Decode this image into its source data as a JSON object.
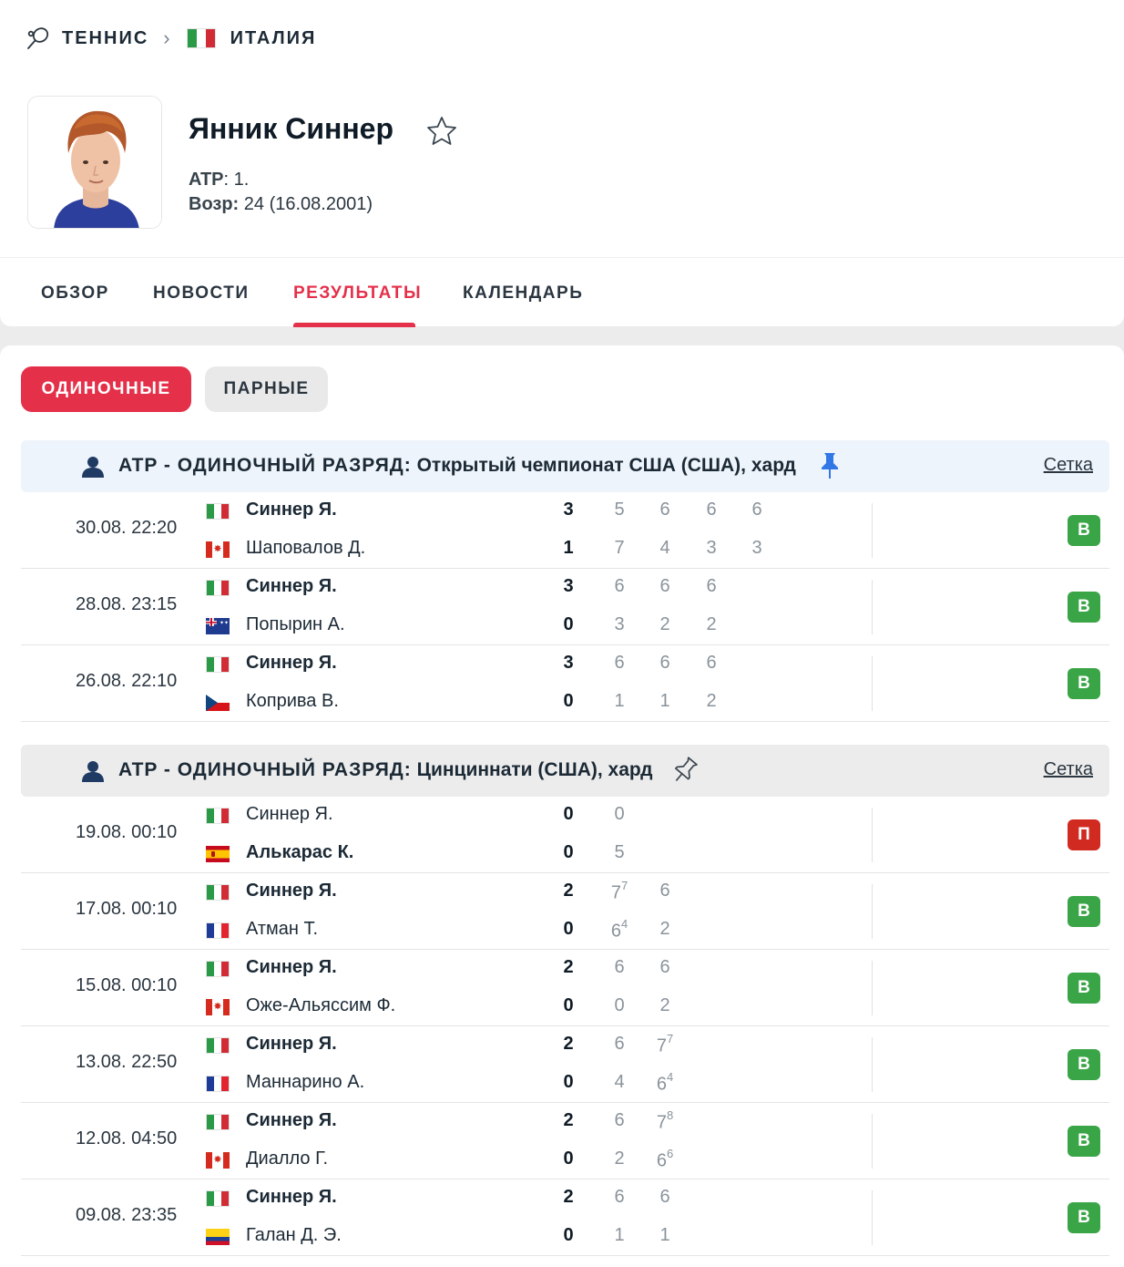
{
  "breadcrumb": {
    "sport": "ТЕННИС",
    "country": "ИТАЛИЯ",
    "sport_icon": "tennis-racket-icon",
    "separator_icon": "chevron-right-icon"
  },
  "player": {
    "name": "Янник Синнер",
    "atp_label": "ATP",
    "atp_value": ": 1.",
    "age_label": "Возр:",
    "age_value": " 24 (16.08.2001)",
    "favorite_icon": "star-outline-icon"
  },
  "tabs": [
    {
      "label": "ОБЗОР",
      "active": false
    },
    {
      "label": "НОВОСТИ",
      "active": false
    },
    {
      "label": "РЕЗУЛЬТАТЫ",
      "active": true
    },
    {
      "label": "КАЛЕНДАРЬ",
      "active": false
    }
  ],
  "filters": {
    "singles": "ОДИНОЧНЫЕ",
    "doubles": "ПАРНЫЕ",
    "active": "singles"
  },
  "colors": {
    "accent": "#e5304a",
    "win": "#3aa547",
    "loss": "#d12a20",
    "pinned_header": "#eef4fb"
  },
  "tournaments": [
    {
      "category": "ATP - ОДИНОЧНЫЙ РАЗРЯД:",
      "name": " Открытый чемпионат США (США), хард",
      "pinned": true,
      "draw_label": "Сетка",
      "matches": [
        {
          "time": "30.08. 22:20",
          "p1": {
            "flag": "it",
            "name": "Синнер Я.",
            "total": "3",
            "sets": [
              "5",
              "6",
              "6",
              "6"
            ],
            "tb": [
              "",
              "",
              "",
              ""
            ],
            "winner": true
          },
          "p2": {
            "flag": "ca",
            "name": "Шаповалов Д.",
            "total": "1",
            "sets": [
              "7",
              "4",
              "3",
              "3"
            ],
            "tb": [
              "",
              "",
              "",
              ""
            ],
            "winner": false
          },
          "result": "В"
        },
        {
          "time": "28.08. 23:15",
          "p1": {
            "flag": "it",
            "name": "Синнер Я.",
            "total": "3",
            "sets": [
              "6",
              "6",
              "6"
            ],
            "tb": [
              "",
              "",
              ""
            ],
            "winner": true
          },
          "p2": {
            "flag": "au",
            "name": "Попырин А.",
            "total": "0",
            "sets": [
              "3",
              "2",
              "2"
            ],
            "tb": [
              "",
              "",
              ""
            ],
            "winner": false
          },
          "result": "В"
        },
        {
          "time": "26.08. 22:10",
          "p1": {
            "flag": "it",
            "name": "Синнер Я.",
            "total": "3",
            "sets": [
              "6",
              "6",
              "6"
            ],
            "tb": [
              "",
              "",
              ""
            ],
            "winner": true
          },
          "p2": {
            "flag": "cz",
            "name": "Коприва В.",
            "total": "0",
            "sets": [
              "1",
              "1",
              "2"
            ],
            "tb": [
              "",
              "",
              ""
            ],
            "winner": false
          },
          "result": "В"
        }
      ]
    },
    {
      "category": "ATP - ОДИНОЧНЫЙ РАЗРЯД:",
      "name": " Цинциннати (США), хард",
      "pinned": false,
      "draw_label": "Сетка",
      "matches": [
        {
          "time": "19.08. 00:10",
          "p1": {
            "flag": "it",
            "name": "Синнер Я.",
            "total": "0",
            "sets": [
              "0"
            ],
            "tb": [
              ""
            ],
            "winner": false
          },
          "p2": {
            "flag": "es",
            "name": "Алькарас К.",
            "total": "0",
            "sets": [
              "5"
            ],
            "tb": [
              ""
            ],
            "winner": true
          },
          "result": "П"
        },
        {
          "time": "17.08. 00:10",
          "p1": {
            "flag": "it",
            "name": "Синнер Я.",
            "total": "2",
            "sets": [
              "7",
              "6"
            ],
            "tb": [
              "7",
              ""
            ],
            "winner": true
          },
          "p2": {
            "flag": "fr",
            "name": "Атман Т.",
            "total": "0",
            "sets": [
              "6",
              "2"
            ],
            "tb": [
              "4",
              ""
            ],
            "winner": false
          },
          "result": "В"
        },
        {
          "time": "15.08. 00:10",
          "p1": {
            "flag": "it",
            "name": "Синнер Я.",
            "total": "2",
            "sets": [
              "6",
              "6"
            ],
            "tb": [
              "",
              ""
            ],
            "winner": true
          },
          "p2": {
            "flag": "ca",
            "name": "Оже-Альяссим Ф.",
            "total": "0",
            "sets": [
              "0",
              "2"
            ],
            "tb": [
              "",
              ""
            ],
            "winner": false
          },
          "result": "В"
        },
        {
          "time": "13.08. 22:50",
          "p1": {
            "flag": "it",
            "name": "Синнер Я.",
            "total": "2",
            "sets": [
              "6",
              "7"
            ],
            "tb": [
              "",
              "7"
            ],
            "winner": true
          },
          "p2": {
            "flag": "fr",
            "name": "Маннарино А.",
            "total": "0",
            "sets": [
              "4",
              "6"
            ],
            "tb": [
              "",
              "4"
            ],
            "winner": false
          },
          "result": "В"
        },
        {
          "time": "12.08. 04:50",
          "p1": {
            "flag": "it",
            "name": "Синнер Я.",
            "total": "2",
            "sets": [
              "6",
              "7"
            ],
            "tb": [
              "",
              "8"
            ],
            "winner": true
          },
          "p2": {
            "flag": "ca",
            "name": "Диалло Г.",
            "total": "0",
            "sets": [
              "2",
              "6"
            ],
            "tb": [
              "",
              "6"
            ],
            "winner": false
          },
          "result": "В"
        },
        {
          "time": "09.08. 23:35",
          "p1": {
            "flag": "it",
            "name": "Синнер Я.",
            "total": "2",
            "sets": [
              "6",
              "6"
            ],
            "tb": [
              "",
              ""
            ],
            "winner": true
          },
          "p2": {
            "flag": "co",
            "name": "Галан Д. Э.",
            "total": "0",
            "sets": [
              "1",
              "1"
            ],
            "tb": [
              "",
              ""
            ],
            "winner": false
          },
          "result": "В"
        }
      ]
    }
  ]
}
